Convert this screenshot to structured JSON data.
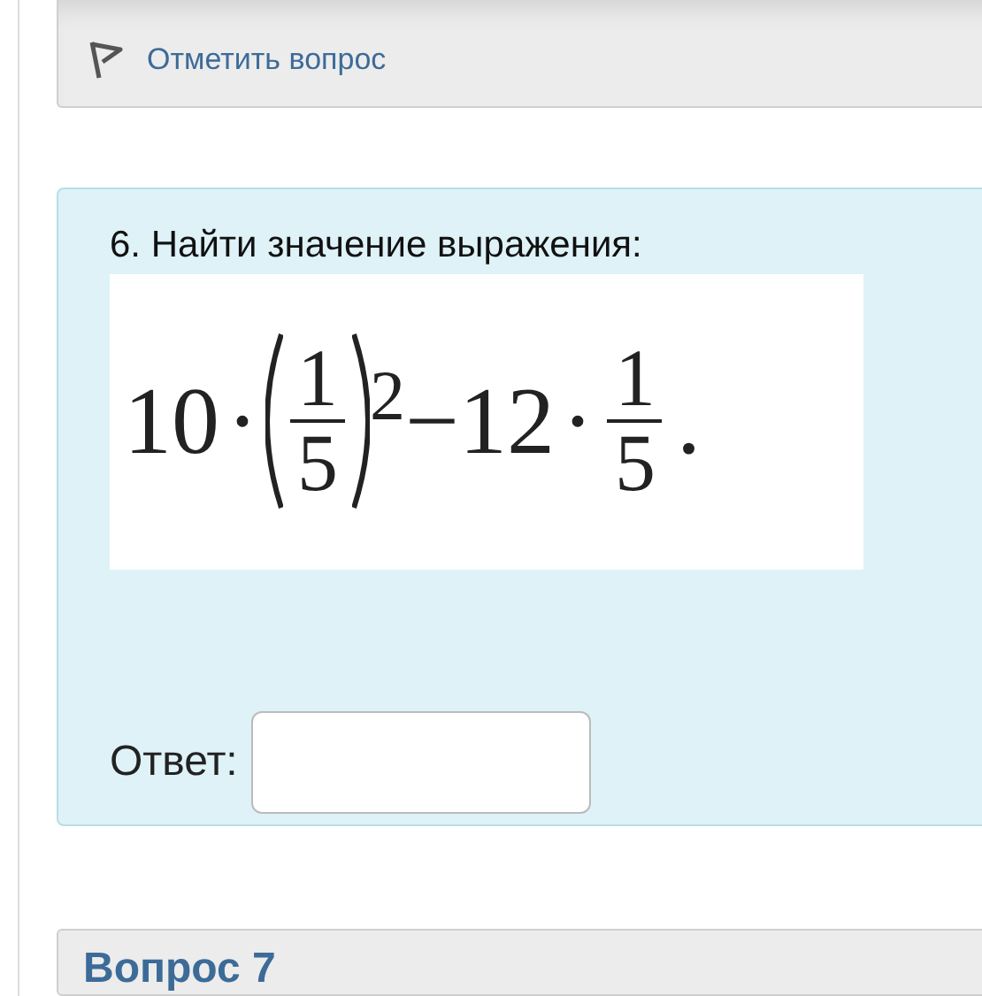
{
  "previous_question": {
    "flag_link": "Отметить вопрос"
  },
  "question": {
    "text": "6. Найти значение выражения:",
    "formula": [
      {
        "kind": "text",
        "text": "10"
      },
      {
        "kind": "dot",
        "text": "·"
      },
      {
        "kind": "power_fraction",
        "numerator": "1",
        "denominator": "5",
        "exponent": "2"
      },
      {
        "kind": "text",
        "text": "−12"
      },
      {
        "kind": "dot",
        "text": "·"
      },
      {
        "kind": "fraction",
        "numerator": "1",
        "denominator": "5"
      },
      {
        "kind": "dot",
        "text": "."
      }
    ],
    "answer_label": "Ответ:"
  },
  "next_question": {
    "title": "Вопрос 7"
  }
}
